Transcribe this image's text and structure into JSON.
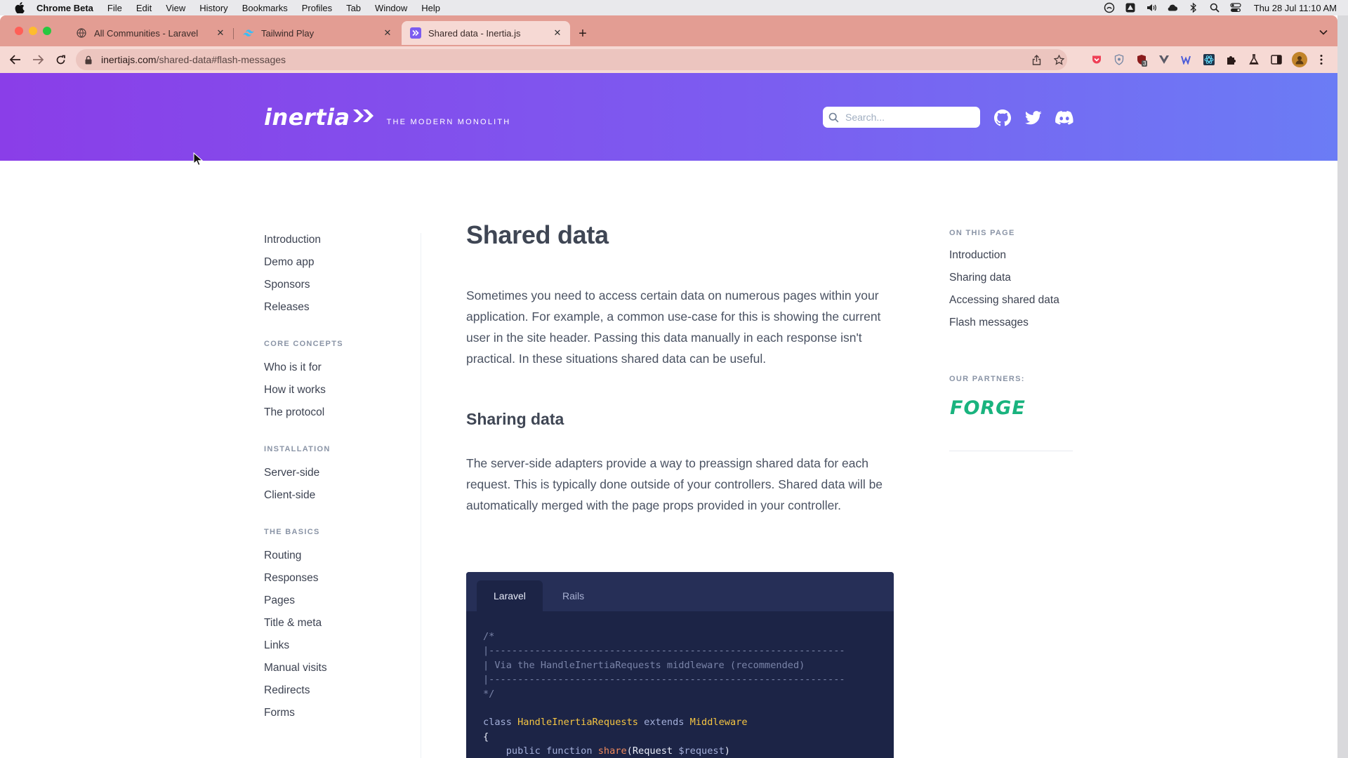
{
  "menubar": {
    "app_name": "Chrome Beta",
    "items": [
      "File",
      "Edit",
      "View",
      "History",
      "Bookmarks",
      "Profiles",
      "Tab",
      "Window",
      "Help"
    ],
    "clock": "Thu 28 Jul  11:10 AM"
  },
  "browser": {
    "tabs": [
      {
        "title": "All Communities - Laravel",
        "favicon": "globe-icon"
      },
      {
        "title": "Tailwind Play",
        "favicon": "tailwind-icon"
      },
      {
        "title": "Shared data - Inertia.js",
        "favicon": "inertia-icon",
        "active": true
      }
    ],
    "url_host": "inertiajs.com",
    "url_path": "/shared-data#flash-messages",
    "extension_badge": "3"
  },
  "header": {
    "logo_text": "inertia",
    "tagline": "THE MODERN MONOLITH",
    "search_placeholder": "Search...",
    "social_icons": [
      "github-icon",
      "twitter-icon",
      "discord-icon"
    ]
  },
  "sidebar": {
    "top_links": [
      "Introduction",
      "Demo app",
      "Sponsors",
      "Releases"
    ],
    "groups": [
      {
        "heading": "CORE CONCEPTS",
        "links": [
          "Who is it for",
          "How it works",
          "The protocol"
        ]
      },
      {
        "heading": "INSTALLATION",
        "links": [
          "Server-side",
          "Client-side"
        ]
      },
      {
        "heading": "THE BASICS",
        "links": [
          "Routing",
          "Responses",
          "Pages",
          "Title & meta",
          "Links",
          "Manual visits",
          "Redirects",
          "Forms"
        ]
      }
    ]
  },
  "main": {
    "title": "Shared data",
    "intro": "Sometimes you need to access certain data on numerous pages within your application. For example, a common use-case for this is showing the current user in the site header. Passing this data manually in each response isn't practical. In these situations shared data can be useful.",
    "section_heading": "Sharing data",
    "section_text": "The server-side adapters provide a way to preassign shared data for each request. This is typically done outside of your controllers. Shared data will be automatically merged with the page props provided in your controller.",
    "code_tabs": [
      "Laravel",
      "Rails"
    ],
    "code": {
      "comment_open": "/*",
      "comment_rule": "|--------------------------------------------------------------",
      "comment_text": "| Via the HandleInertiaRequests middleware (recommended)",
      "comment_close": "*/",
      "kw_class": "class",
      "class_name": "HandleInertiaRequests",
      "kw_extends": "extends",
      "parent_class": "Middleware",
      "brace_open": "{",
      "kw_public": "public",
      "kw_function": "function",
      "fn_name": "share",
      "param_type": "Request",
      "param_var": "$request",
      "paren_open": "(",
      "paren_close": ")",
      "indent_brace": "{"
    }
  },
  "toc": {
    "heading": "ON THIS PAGE",
    "links": [
      "Introduction",
      "Sharing data",
      "Accessing shared data",
      "Flash messages"
    ],
    "partners_heading": "OUR PARTNERS:",
    "partner_logo": "FORGE"
  },
  "colors": {
    "hero_start": "#8a3ee8",
    "hero_end": "#6b7cf5",
    "tabstrip": "#e39d93",
    "code_bg": "#1c2446",
    "forge_green": "#19b37e"
  }
}
